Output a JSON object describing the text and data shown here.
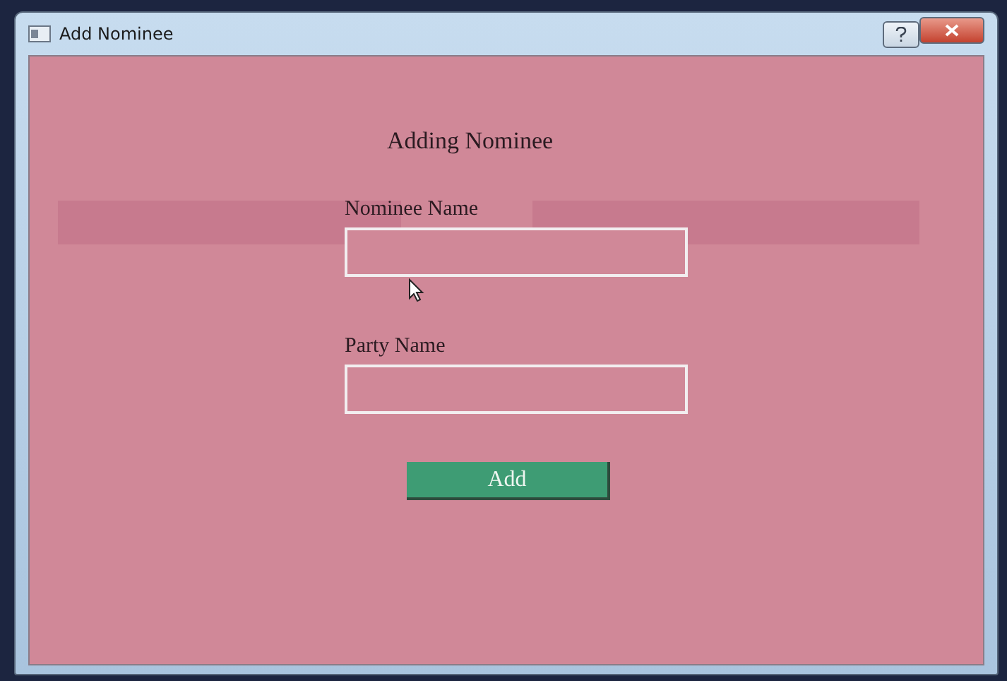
{
  "window": {
    "title": "Add Nominee"
  },
  "heading": "Adding Nominee",
  "fields": [
    {
      "label": "Nominee Name"
    },
    {
      "label": "Party Name"
    }
  ],
  "submit": {
    "label": "Add"
  }
}
